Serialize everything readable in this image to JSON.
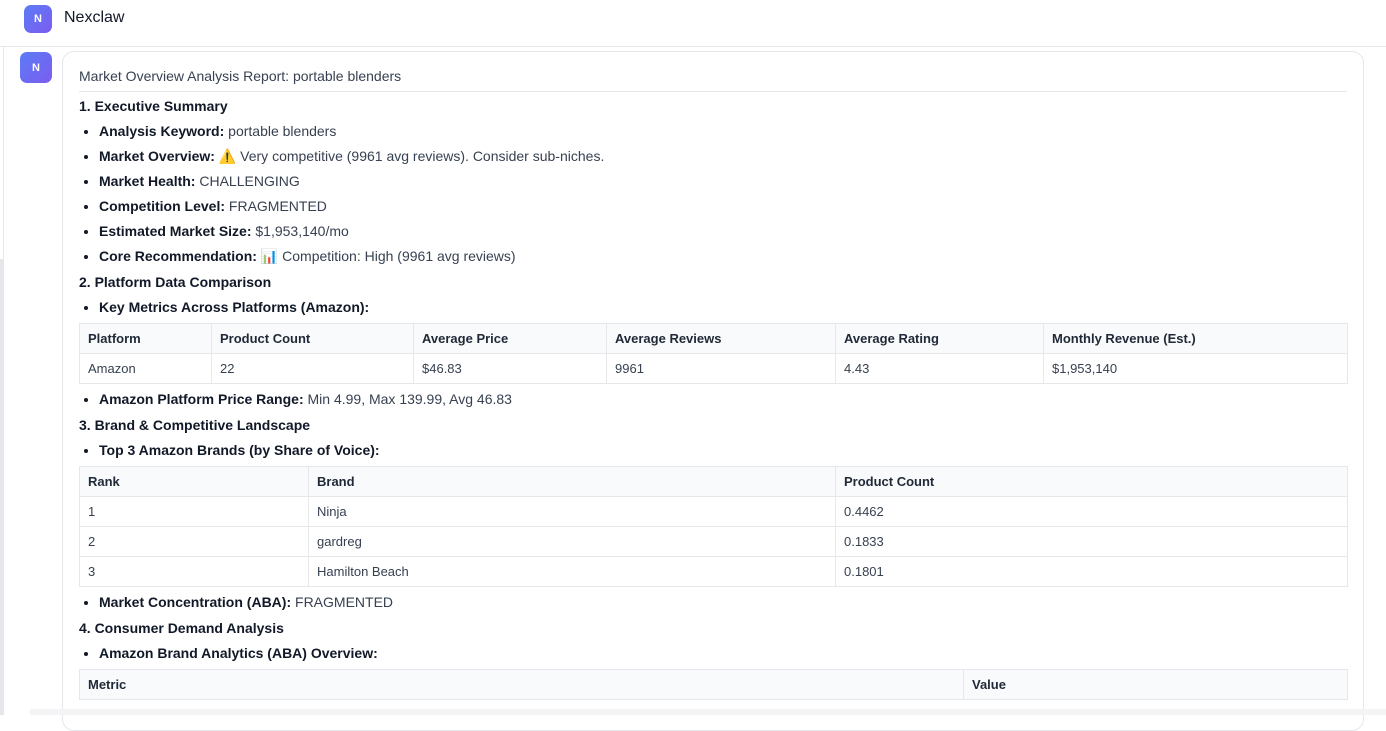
{
  "app": {
    "title": "Nexclaw",
    "avatar_letter": "N"
  },
  "message": {
    "avatar_letter": "N",
    "report_title": "Market Overview Analysis Report: portable blenders",
    "sections": {
      "s1": {
        "heading": "1. Executive Summary",
        "items": [
          {
            "label": "Analysis Keyword:",
            "value": "portable blenders"
          },
          {
            "label": "Market Overview:",
            "value": "⚠️ Very competitive (9961 avg reviews). Consider sub-niches."
          },
          {
            "label": "Market Health:",
            "value": "CHALLENGING"
          },
          {
            "label": "Competition Level:",
            "value": "FRAGMENTED"
          },
          {
            "label": "Estimated Market Size:",
            "value": "$1,953,140/mo"
          },
          {
            "label": "Core Recommendation:",
            "value": "📊 Competition: High (9961 avg reviews)"
          }
        ]
      },
      "s2": {
        "heading": "2. Platform Data Comparison",
        "intro": "Key Metrics Across Platforms (Amazon):",
        "table": {
          "headers": [
            "Platform",
            "Product Count",
            "Average Price",
            "Average Reviews",
            "Average Rating",
            "Monthly Revenue (Est.)"
          ],
          "rows": [
            [
              "Amazon",
              "22",
              "$46.83",
              "9961",
              "4.43",
              "$1,953,140"
            ]
          ]
        },
        "after": {
          "label": "Amazon Platform Price Range:",
          "value": "Min 4.99, Max 139.99, Avg 46.83"
        }
      },
      "s3": {
        "heading": "3. Brand & Competitive Landscape",
        "intro": "Top 3 Amazon Brands (by Share of Voice):",
        "table": {
          "headers": [
            "Rank",
            "Brand",
            "Product Count"
          ],
          "rows": [
            [
              "1",
              "Ninja",
              "0.4462"
            ],
            [
              "2",
              "gardreg",
              "0.1833"
            ],
            [
              "3",
              "Hamilton Beach",
              "0.1801"
            ]
          ]
        },
        "after": {
          "label": "Market Concentration (ABA):",
          "value": "FRAGMENTED"
        }
      },
      "s4": {
        "heading": "4. Consumer Demand Analysis",
        "intro": "Amazon Brand Analytics (ABA) Overview:",
        "table": {
          "headers": [
            "Metric",
            "Value"
          ]
        }
      }
    }
  }
}
